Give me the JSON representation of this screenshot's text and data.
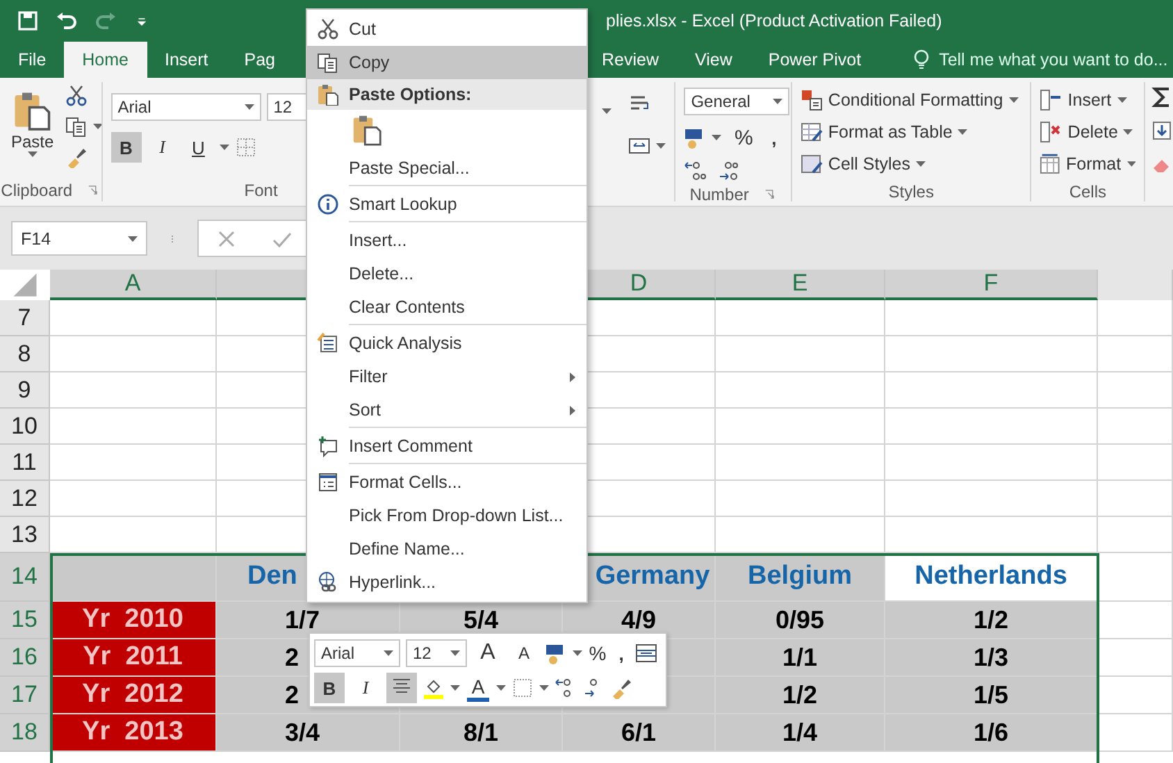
{
  "window": {
    "title": "plies.xlsx - Excel (Product Activation Failed)"
  },
  "tabs": [
    {
      "label": "File",
      "selected": false
    },
    {
      "label": "Home",
      "selected": true
    },
    {
      "label": "Insert",
      "selected": false
    },
    {
      "label": "Pag",
      "selected": false
    },
    {
      "label": "Review",
      "selected": false
    },
    {
      "label": "View",
      "selected": false
    },
    {
      "label": "Power Pivot",
      "selected": false
    }
  ],
  "tell_me": {
    "placeholder": "Tell me what you want to do..."
  },
  "ribbon": {
    "clipboard": {
      "paste": "Paste",
      "label": "Clipboard"
    },
    "font": {
      "family": "Arial",
      "size": "12",
      "label": "Font",
      "buttons": [
        {
          "label": "B",
          "pressed": true
        },
        {
          "label": "I",
          "pressed": false
        },
        {
          "label": "U",
          "pressed": false
        }
      ]
    },
    "number": {
      "format": "General",
      "percent": "%",
      "comma": ",",
      "label": "Number"
    },
    "styles": {
      "items": [
        "Conditional Formatting",
        "Format as Table",
        "Cell Styles"
      ],
      "label": "Styles"
    },
    "cells": {
      "items": [
        "Insert",
        "Delete",
        "Format"
      ],
      "label": "Cells"
    }
  },
  "formula_bar": {
    "name_box": "F14"
  },
  "sheet": {
    "columns": [
      {
        "label": "A",
        "selected": true
      },
      {
        "selected": true
      },
      {},
      {
        "label": "D",
        "selected": true
      },
      {
        "label": "E",
        "selected": true
      },
      {
        "label": "F",
        "selected": true
      }
    ],
    "rows": [
      {
        "header": "7",
        "kind": "blank",
        "selected": false,
        "cells": []
      },
      {
        "header": "8",
        "kind": "blank",
        "selected": false,
        "cells": []
      },
      {
        "header": "9",
        "kind": "blank",
        "selected": false,
        "cells": []
      },
      {
        "header": "10",
        "kind": "blank",
        "selected": false,
        "cells": []
      },
      {
        "header": "11",
        "kind": "blank",
        "selected": false,
        "cells": []
      },
      {
        "header": "12",
        "kind": "blank",
        "selected": false,
        "cells": []
      },
      {
        "header": "13",
        "kind": "blank",
        "selected": false,
        "cells": []
      },
      {
        "header": "14",
        "kind": "heading",
        "selected": true,
        "cells": [
          {
            "selected": false
          },
          {
            "text": "Den",
            "selected": false
          },
          {},
          {
            "text": "Germany",
            "selected": false
          },
          {
            "text": "Belgium",
            "selected": false
          },
          {
            "text": "Netherlands",
            "selected": true
          }
        ]
      },
      {
        "header": "15",
        "kind": "data",
        "selected": true,
        "cells": [
          "Yr  2010",
          "1/7",
          "5/4",
          "4/9",
          "0/95",
          "1/2"
        ]
      },
      {
        "header": "16",
        "kind": "data",
        "selected": true,
        "cells": [
          "Yr  2011",
          "2",
          null,
          null,
          "1/1",
          "1/3"
        ]
      },
      {
        "header": "17",
        "kind": "data",
        "selected": true,
        "cells": [
          "Yr  2012",
          "2",
          null,
          null,
          "1/2",
          "1/5"
        ]
      },
      {
        "header": "18",
        "kind": "data",
        "selected": true,
        "cells": [
          "Yr  2013",
          "3/4",
          "8/1",
          "6/1",
          "1/4",
          "1/6"
        ]
      }
    ]
  },
  "context_menu": {
    "items": [
      {
        "kind": "item",
        "label": "Cut",
        "selected": false
      },
      {
        "kind": "item",
        "label": "Copy",
        "selected": true
      },
      {
        "kind": "header",
        "label": "Paste Options:"
      },
      {
        "kind": "paste-options"
      },
      {
        "kind": "item",
        "label": "Paste Special...",
        "selected": false
      },
      {
        "kind": "separator"
      },
      {
        "kind": "item",
        "label": "Smart Lookup",
        "selected": false
      },
      {
        "kind": "separator"
      },
      {
        "kind": "item",
        "label": "Insert...",
        "selected": false
      },
      {
        "kind": "item",
        "label": "Delete...",
        "selected": false
      },
      {
        "kind": "item",
        "label": "Clear Contents",
        "selected": false
      },
      {
        "kind": "separator"
      },
      {
        "kind": "item",
        "label": "Quick Analysis",
        "selected": false
      },
      {
        "kind": "item",
        "label": "Filter",
        "submenu": true,
        "selected": false
      },
      {
        "kind": "item",
        "label": "Sort",
        "submenu": true,
        "selected": false
      },
      {
        "kind": "separator"
      },
      {
        "kind": "item",
        "label": "Insert Comment",
        "selected": false
      },
      {
        "kind": "separator"
      },
      {
        "kind": "item",
        "label": "Format Cells...",
        "selected": false
      },
      {
        "kind": "item",
        "label": "Pick From Drop-down List...",
        "selected": false
      },
      {
        "kind": "item",
        "label": "Define Name...",
        "selected": false
      },
      {
        "kind": "item",
        "label": "Hyperlink...",
        "selected": false
      }
    ]
  },
  "mini_toolbar": {
    "font": "Arial",
    "size": "12",
    "grow": "A",
    "shrink": "A",
    "percent": "%",
    "comma": ",",
    "font_color": "A",
    "buttons": [
      {
        "label": "B",
        "pressed": true
      },
      {
        "label": "I",
        "pressed": false
      }
    ],
    "center_pressed": true
  }
}
